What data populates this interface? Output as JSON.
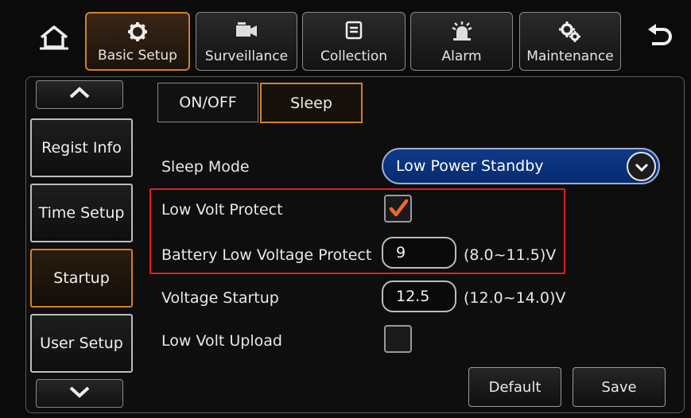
{
  "toolbar": {
    "home_icon": "home-icon",
    "back_icon": "back-arrow-icon",
    "tabs": [
      {
        "label": "Basic Setup",
        "icon": "gear-icon",
        "active": true
      },
      {
        "label": "Surveillance",
        "icon": "video-camera-icon",
        "active": false
      },
      {
        "label": "Collection",
        "icon": "document-icon",
        "active": false
      },
      {
        "label": "Alarm",
        "icon": "alarm-light-icon",
        "active": false
      },
      {
        "label": "Maintenance",
        "icon": "gears-icon",
        "active": false
      }
    ]
  },
  "sidebar": {
    "up_icon": "chevron-up-icon",
    "down_icon": "chevron-down-icon",
    "items": [
      {
        "label": "Regist Info",
        "active": false
      },
      {
        "label": "Time Setup",
        "active": false
      },
      {
        "label": "Startup",
        "active": true
      },
      {
        "label": "User Setup",
        "active": false
      }
    ]
  },
  "subtabs": [
    {
      "label": "ON/OFF",
      "active": false
    },
    {
      "label": "Sleep",
      "active": true
    }
  ],
  "form": {
    "sleep_mode": {
      "label": "Sleep Mode",
      "value": "Low Power Standby"
    },
    "low_volt_protect": {
      "label": "Low Volt Protect",
      "checked": true
    },
    "battery_low_voltage": {
      "label": "Battery Low Voltage Protect",
      "value": "9",
      "range": "(8.0~11.5)V"
    },
    "voltage_startup": {
      "label": "Voltage Startup",
      "value": "12.5",
      "range": "(12.0~14.0)V"
    },
    "low_volt_upload": {
      "label": "Low Volt Upload",
      "checked": false
    }
  },
  "actions": {
    "default_label": "Default",
    "save_label": "Save"
  },
  "colors": {
    "accent": "#d4802a",
    "highlight": "#e12020",
    "select_bg": "#0f3a8a"
  }
}
